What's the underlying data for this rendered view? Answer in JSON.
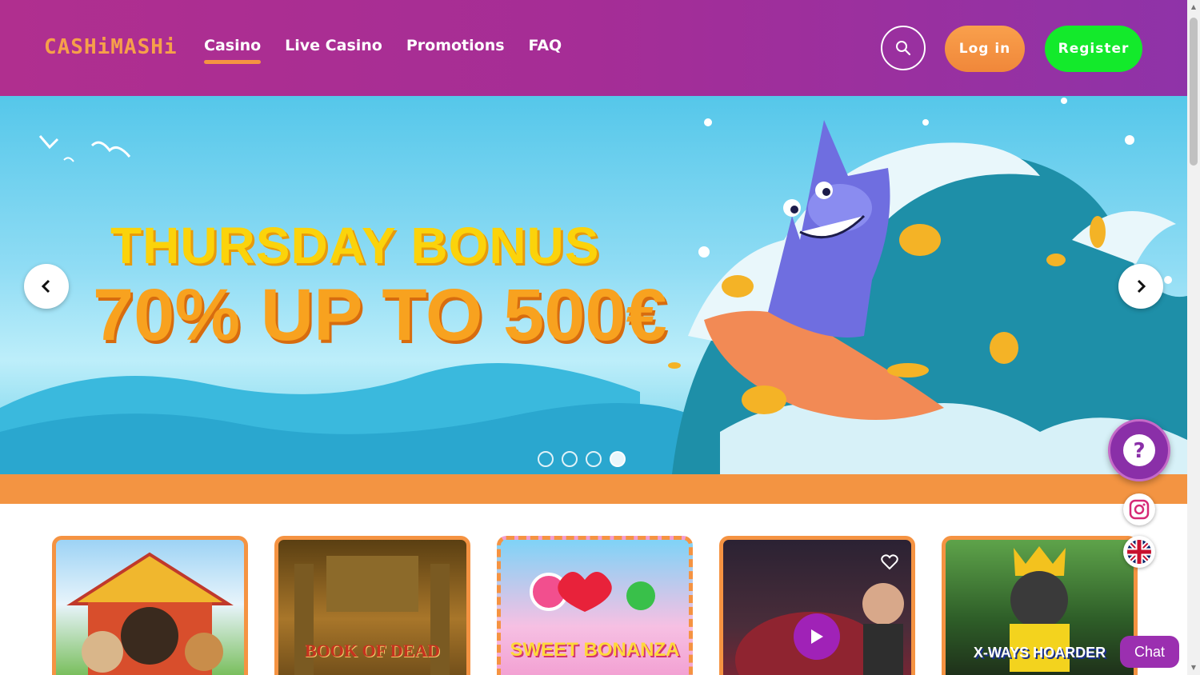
{
  "header": {
    "logo": "CASHiMASHi",
    "nav": [
      {
        "label": "Casino",
        "active": true
      },
      {
        "label": "Live Casino",
        "active": false
      },
      {
        "label": "Promotions",
        "active": false
      },
      {
        "label": "FAQ",
        "active": false
      }
    ],
    "search_icon": "search-icon",
    "login_label": "Log in",
    "register_label": "Register"
  },
  "banner": {
    "title_line1": "THURSDAY BONUS",
    "title_line2": "70% UP TO 500€",
    "slide_count": 4,
    "active_slide": 4
  },
  "games": [
    {
      "name": "dog-house",
      "label": ""
    },
    {
      "name": "book-of-dead",
      "label": "BOOK OF DEAD"
    },
    {
      "name": "sweet-bonanza",
      "label": "SWEET BONANZA"
    },
    {
      "name": "crazy-time",
      "label": ""
    },
    {
      "name": "xways-hoarder",
      "label": "X-WAYS HOARDER"
    }
  ],
  "widgets": {
    "help_icon": "question-icon",
    "instagram_icon": "instagram-icon",
    "language_icon": "uk-flag-icon",
    "chat_label": "Chat"
  },
  "colors": {
    "header_start": "#b02f8f",
    "header_end": "#8f33a8",
    "accent_orange": "#f59342",
    "register_green": "#13ea2b",
    "chat_purple": "#9b2fb0"
  }
}
